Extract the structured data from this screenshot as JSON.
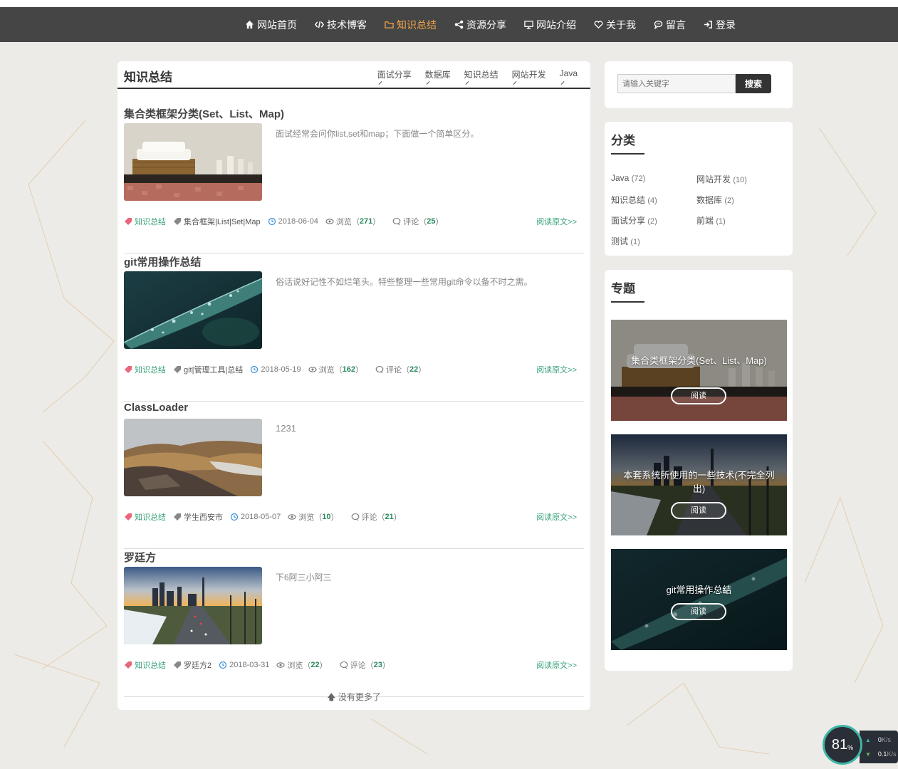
{
  "nav": {
    "items": [
      {
        "label": "网站首页",
        "icon": "home-icon"
      },
      {
        "label": "技术博客",
        "icon": "code-icon"
      },
      {
        "label": "知识总结",
        "icon": "folder-icon",
        "active": true
      },
      {
        "label": "资源分享",
        "icon": "share-icon"
      },
      {
        "label": "网站介绍",
        "icon": "monitor-icon"
      },
      {
        "label": "关于我",
        "icon": "heart-icon"
      },
      {
        "label": "留言",
        "icon": "comment-icon"
      },
      {
        "label": "登录",
        "icon": "login-icon"
      }
    ],
    "active_color": "#f0a348"
  },
  "main": {
    "title": "知识总结",
    "tabs": [
      "面试分享",
      "数据库",
      "知识总结",
      "网站开发",
      "Java"
    ],
    "posts": [
      {
        "title": "集合类框架分类(Set、List、Map)",
        "excerpt": "面试经常会问你list,set和map；下面做一个简单区分。",
        "category": "知识总结",
        "tags": "集合框架|List|Set|Map",
        "date": "2018-06-04",
        "views_label": "浏览",
        "views": "271",
        "comments_label": "评论",
        "comments": "25",
        "read_more": "阅读原文>>",
        "image": "towels-shelf"
      },
      {
        "title": "git常用操作总结",
        "excerpt": "俗话说好记性不如烂笔头。特些整理一些常用git命令以备不时之需。",
        "category": "知识总结",
        "tags": "git|管理工具|总结",
        "date": "2018-05-19",
        "views_label": "浏览",
        "views": "162",
        "comments_label": "评论",
        "comments": "22",
        "read_more": "阅读原文>>",
        "image": "leaf-droplets"
      },
      {
        "title": "ClassLoader",
        "excerpt": "1231",
        "category": "知识总结",
        "tags": "学生西安市",
        "date": "2018-05-07",
        "views_label": "浏览",
        "views": "10",
        "comments_label": "评论",
        "comments": "21",
        "read_more": "阅读原文>>",
        "image": "mountain-landscape"
      },
      {
        "title": "罗廷方",
        "excerpt": "下6阿三小阿三",
        "category": "知识总结",
        "tags": "罗廷方2",
        "date": "2018-03-31",
        "views_label": "浏览",
        "views": "22",
        "comments_label": "评论",
        "comments": "23",
        "read_more": "阅读原文>>",
        "image": "city-highway"
      }
    ],
    "no_more": "没有更多了"
  },
  "sidebar": {
    "search": {
      "placeholder": "请输入关键字",
      "button": "搜索"
    },
    "categories": {
      "title": "分类",
      "items": [
        {
          "name": "Java",
          "count": "(72)"
        },
        {
          "name": "网站开发",
          "count": "(10)"
        },
        {
          "name": "知识总结",
          "count": "(4)"
        },
        {
          "name": "数据库",
          "count": "(2)"
        },
        {
          "name": "面试分享",
          "count": "(2)"
        },
        {
          "name": "前端",
          "count": "(1)"
        },
        {
          "name": "测试",
          "count": "(1)"
        }
      ]
    },
    "topics": {
      "title": "专题",
      "items": [
        {
          "title": "集合类框架分类(Set、List、Map)",
          "button": "阅读",
          "image": "towels-shelf"
        },
        {
          "title": "本套系统所使用的一些技术(不完全列出)",
          "button": "阅读",
          "image": "city-highway"
        },
        {
          "title": "git常用操作总结",
          "button": "阅读",
          "image": "leaf-droplets"
        }
      ]
    }
  },
  "widget": {
    "percent": "81",
    "percent_unit": "%",
    "up": "0",
    "up_unit": "K/s",
    "down": "0.1",
    "down_unit": "K/s"
  }
}
